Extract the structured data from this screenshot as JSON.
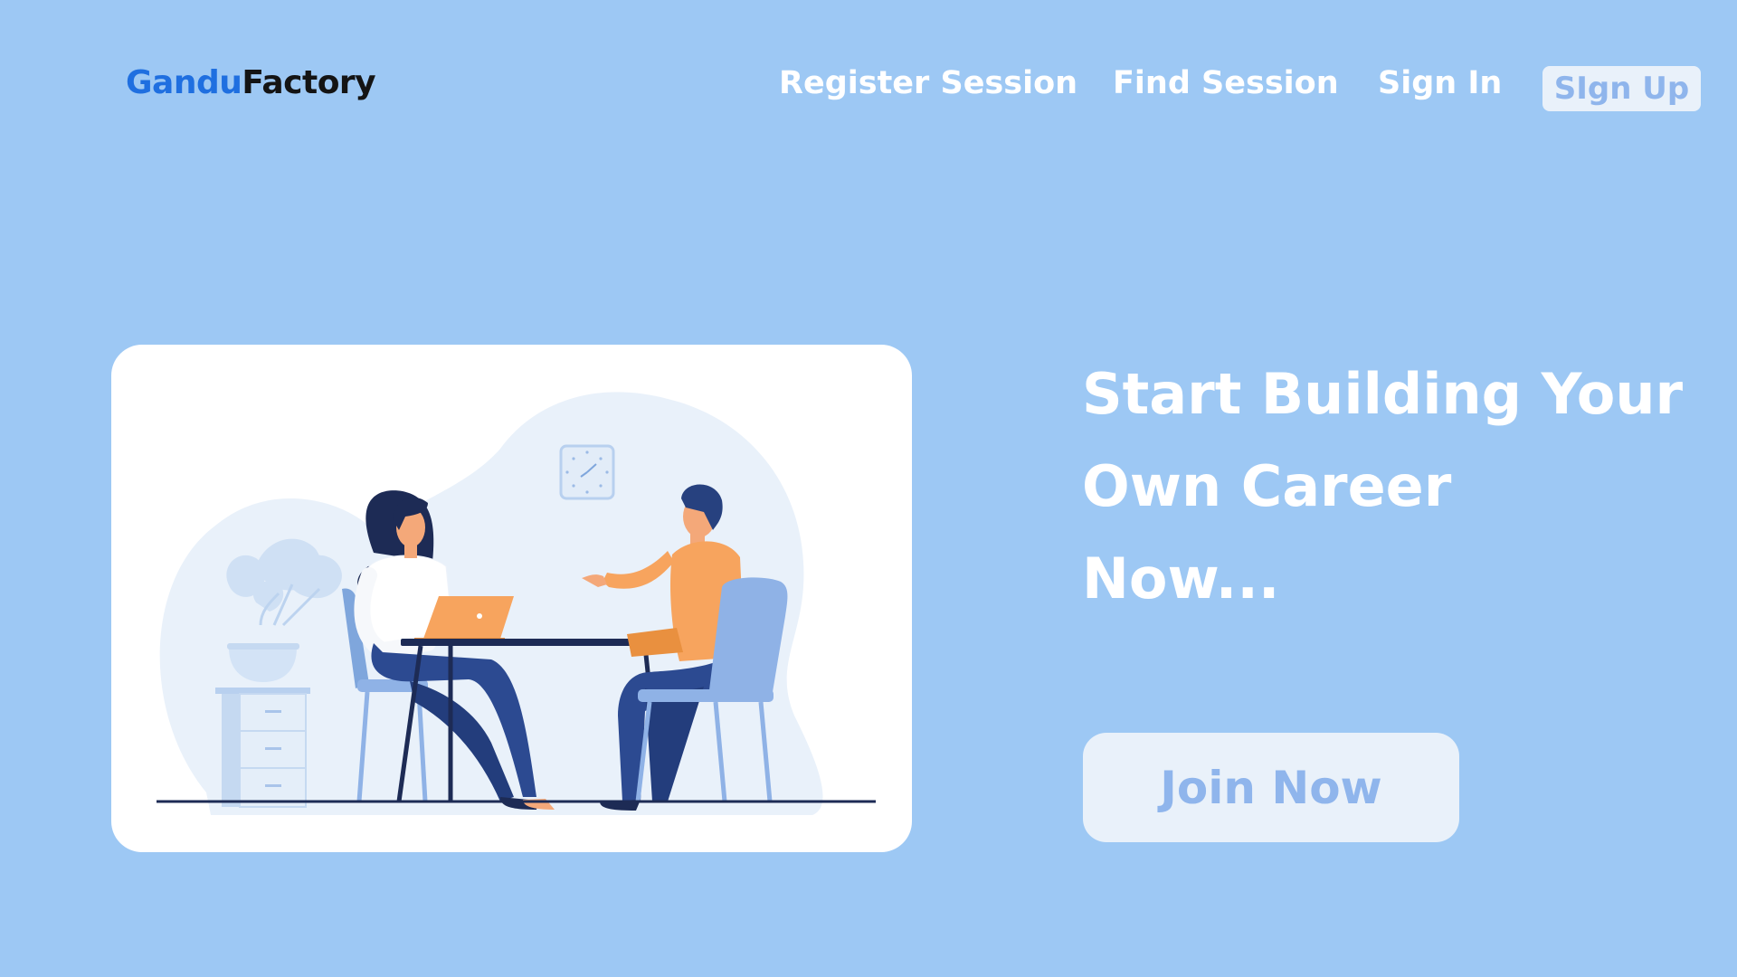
{
  "header": {
    "logo": {
      "part1": "Gandu",
      "part2": "Factory"
    },
    "nav": {
      "register_session": "Register Session",
      "find_session": "Find Session",
      "sign_in": "Sign In",
      "sign_up": "SIgn Up"
    }
  },
  "hero": {
    "headline_lines": [
      "Start Building Your",
      "Own Career",
      "Now..."
    ],
    "cta_label": "Join Now",
    "illustration": "interview-illustration"
  },
  "colors": {
    "background": "#9dc8f4",
    "brand_blue": "#1f6fe0",
    "brand_dark": "#141414",
    "button_bg": "#e9f1fa",
    "button_text": "#8fb5ec",
    "white": "#ffffff"
  }
}
